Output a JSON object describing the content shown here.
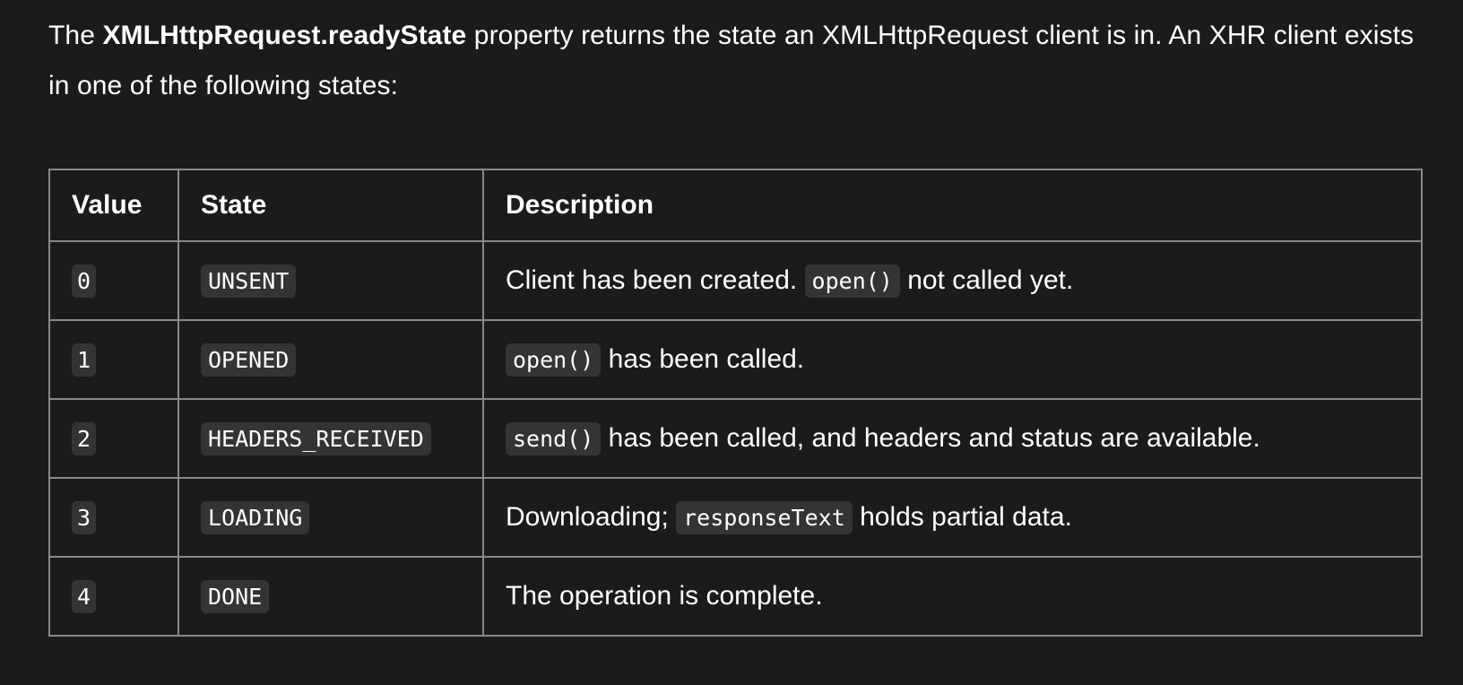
{
  "intro": {
    "prefix": "The ",
    "property": "XMLHttpRequest.readyState",
    "suffix": " property returns the state an XMLHttpRequest client is in. An XHR client exists in one of the following states:"
  },
  "table": {
    "headers": [
      "Value",
      "State",
      "Description"
    ],
    "rows": [
      {
        "value": "0",
        "state": "UNSENT",
        "desc_before": "Client has been created. ",
        "desc_code": "open()",
        "desc_after": " not called yet."
      },
      {
        "value": "1",
        "state": "OPENED",
        "desc_before": "",
        "desc_code": "open()",
        "desc_after": " has been called."
      },
      {
        "value": "2",
        "state": "HEADERS_RECEIVED",
        "desc_before": "",
        "desc_code": "send()",
        "desc_after": " has been called, and headers and status are available."
      },
      {
        "value": "3",
        "state": "LOADING",
        "desc_before": "Downloading; ",
        "desc_code": "responseText",
        "desc_after": " holds partial data."
      },
      {
        "value": "4",
        "state": "DONE",
        "desc_before": "The operation is complete.",
        "desc_code": "",
        "desc_after": ""
      }
    ]
  }
}
